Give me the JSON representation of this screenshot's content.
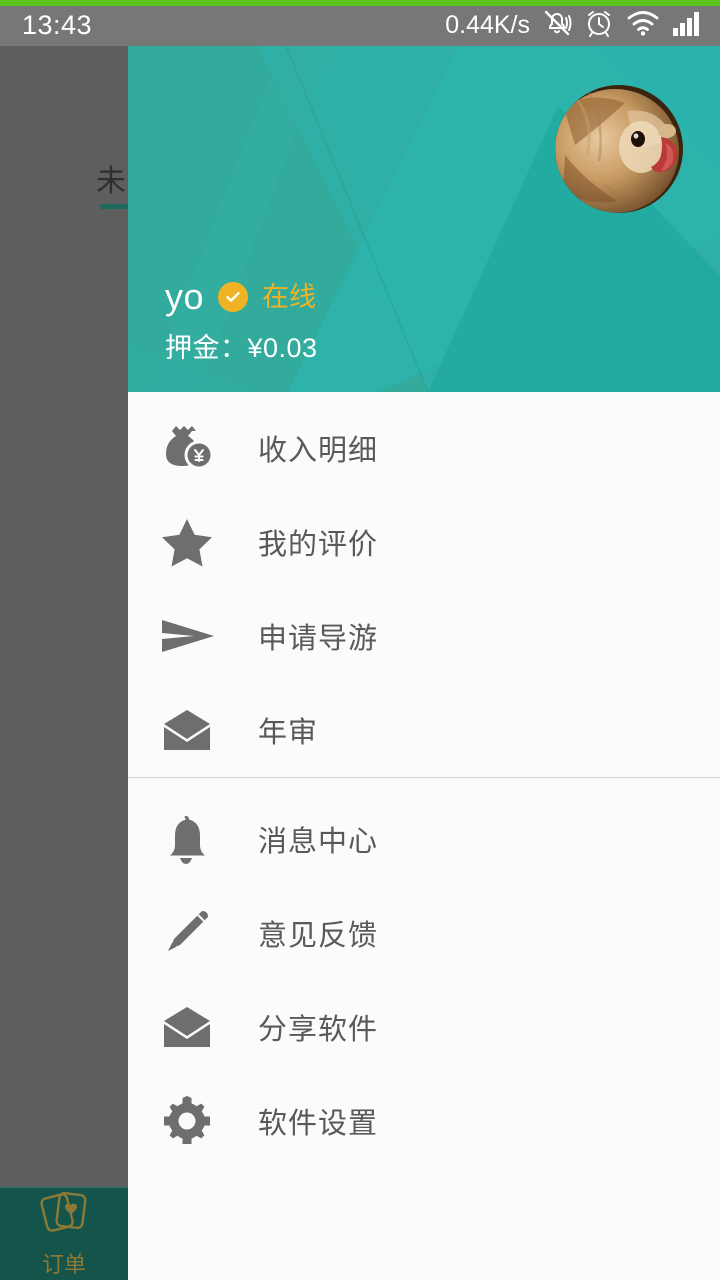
{
  "status_bar": {
    "time": "13:43",
    "net_speed": "0.44K/s",
    "icons": [
      "vibrate-off-icon",
      "alarm-clock-icon",
      "wifi-icon",
      "signal-bars-icon"
    ]
  },
  "background_app": {
    "tab_label_partial": "未",
    "bottom_nav": {
      "label": "订单",
      "icon": "cards-heart-icon"
    }
  },
  "drawer": {
    "header": {
      "user_name": "yo",
      "verified_icon": "check-badge-icon",
      "online_status": "在线",
      "deposit_label": "押金：¥0.03",
      "avatar_icon": "dog-avatar"
    },
    "menu_groups": [
      {
        "items": [
          {
            "icon": "money-bag-icon",
            "label": "收入明细"
          },
          {
            "icon": "star-icon",
            "label": "我的评价"
          },
          {
            "icon": "send-icon",
            "label": "申请导游"
          },
          {
            "icon": "envelope-icon",
            "label": "年审"
          }
        ]
      },
      {
        "items": [
          {
            "icon": "bell-icon",
            "label": "消息中心"
          },
          {
            "icon": "pencil-icon",
            "label": "意见反馈"
          },
          {
            "icon": "envelope-icon",
            "label": "分享软件"
          },
          {
            "icon": "gear-icon",
            "label": "软件设置"
          }
        ]
      }
    ]
  },
  "colors": {
    "header_teal": "#32ab9d",
    "accent_amber": "#f0b323",
    "status_bar_gray": "#777777",
    "top_green": "#5bc319",
    "backdrop_gray": "#5e5e5e",
    "bottom_nav_teal": "#14544b",
    "menu_text": "#595959",
    "icon_gray": "#6e6e6e"
  }
}
